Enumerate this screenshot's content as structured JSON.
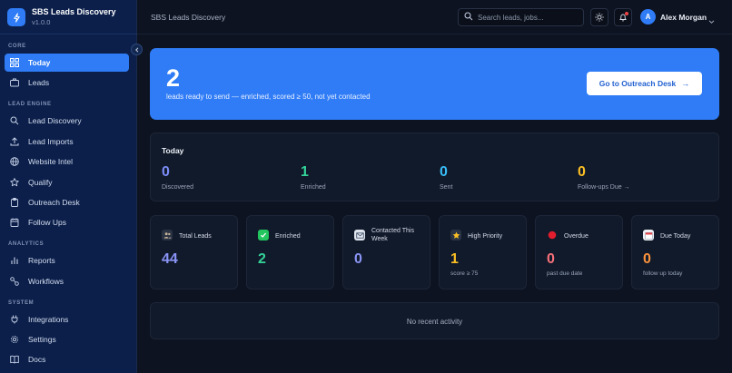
{
  "app": {
    "name": "SBS Leads Discovery",
    "version": "v1.0.0"
  },
  "sidebar": {
    "sections": [
      {
        "label": "CORE",
        "items": [
          {
            "label": "Today",
            "icon": "grid-icon",
            "active": true
          },
          {
            "label": "Leads",
            "icon": "briefcase-icon"
          }
        ]
      },
      {
        "label": "LEAD ENGINE",
        "items": [
          {
            "label": "Lead Discovery",
            "icon": "search-icon"
          },
          {
            "label": "Lead Imports",
            "icon": "upload-icon"
          },
          {
            "label": "Website Intel",
            "icon": "globe-icon"
          },
          {
            "label": "Qualify",
            "icon": "star-icon"
          },
          {
            "label": "Outreach Desk",
            "icon": "clipboard-icon"
          },
          {
            "label": "Follow Ups",
            "icon": "calendar-icon"
          }
        ]
      },
      {
        "label": "ANALYTICS",
        "items": [
          {
            "label": "Reports",
            "icon": "bar-chart-icon"
          },
          {
            "label": "Workflows",
            "icon": "workflow-icon"
          }
        ]
      },
      {
        "label": "SYSTEM",
        "items": [
          {
            "label": "Integrations",
            "icon": "plug-icon"
          },
          {
            "label": "Settings",
            "icon": "gear-icon"
          },
          {
            "label": "Docs",
            "icon": "book-icon"
          }
        ]
      }
    ]
  },
  "topbar": {
    "title": "SBS Leads Discovery",
    "search_placeholder": "Search leads, jobs...",
    "user": {
      "initial": "A",
      "name": "Alex Morgan"
    }
  },
  "hero": {
    "count": "2",
    "description": "leads ready to send — enriched, scored ≥ 50, not yet contacted",
    "cta_label": "Go to Outreach Desk",
    "cta_arrow": "→"
  },
  "today": {
    "title": "Today",
    "stats": [
      {
        "value": "0",
        "label": "Discovered",
        "color": "#7b8cf7"
      },
      {
        "value": "1",
        "label": "Enriched",
        "color": "#34d399"
      },
      {
        "value": "0",
        "label": "Sent",
        "color": "#38bdf8"
      },
      {
        "value": "0",
        "label": "Follow-ups Due →",
        "color": "#fbbf24"
      }
    ]
  },
  "cards": [
    {
      "title": "Total Leads",
      "value": "44",
      "sub": "",
      "icon": "users-icon",
      "color": "#8b95f7"
    },
    {
      "title": "Enriched",
      "value": "2",
      "sub": "",
      "icon": "checkmark-icon",
      "color": "#34d399"
    },
    {
      "title": "Contacted This Week",
      "value": "0",
      "sub": "",
      "icon": "envelope-icon",
      "color": "#8b95f7"
    },
    {
      "title": "High Priority",
      "value": "1",
      "sub": "score ≥ 75",
      "icon": "star-icon",
      "color": "#fbbf24"
    },
    {
      "title": "Overdue",
      "value": "0",
      "sub": "past due date",
      "icon": "red-circle-icon",
      "color": "#f8717a"
    },
    {
      "title": "Due Today",
      "value": "0",
      "sub": "follow up today",
      "icon": "calendar-icon",
      "color": "#fb923c"
    }
  ],
  "activity": {
    "empty_text": "No recent activity"
  }
}
